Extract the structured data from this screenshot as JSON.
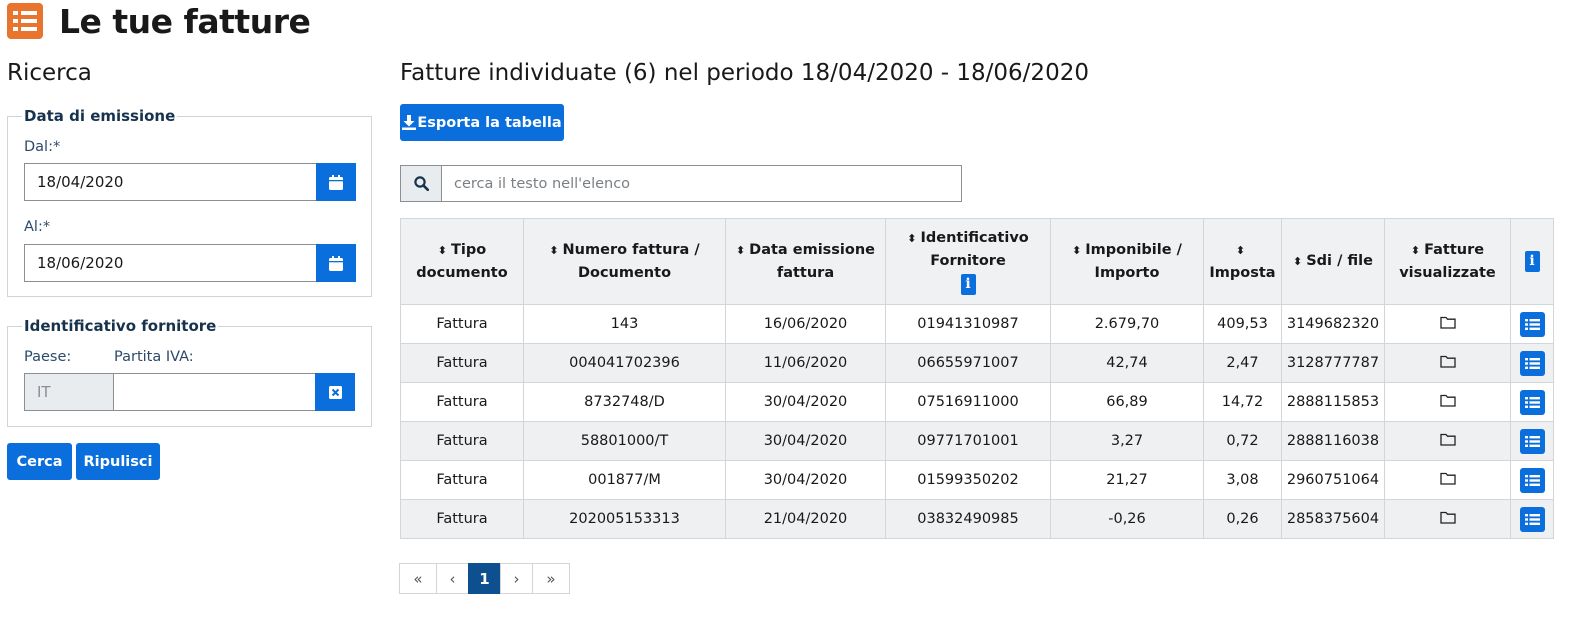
{
  "header": {
    "title": "Le tue fatture",
    "icon": "list-icon"
  },
  "sidebar": {
    "title": "Ricerca",
    "date_group": {
      "legend": "Data di emissione",
      "from_label": "Dal:*",
      "from_value": "18/04/2020",
      "to_label": "Al:*",
      "to_value": "18/06/2020"
    },
    "supplier_group": {
      "legend": "Identificativo fornitore",
      "country_label": "Paese:",
      "vat_label": "Partita IVA:",
      "country_value": "IT",
      "vat_value": ""
    },
    "search_button": "Cerca",
    "reset_button": "Ripulisci"
  },
  "results": {
    "title": "Fatture individuate (6) nel periodo 18/04/2020 - 18/06/2020",
    "export_button": "Esporta la tabella",
    "search_placeholder": "cerca il testo nell'elenco",
    "columns": [
      {
        "l1": "Tipo",
        "l2": "documento"
      },
      {
        "l1": "Numero fattura /",
        "l2": "Documento"
      },
      {
        "l1": "Data emissione",
        "l2": "fattura"
      },
      {
        "l1": "Identificativo",
        "l2": "Fornitore"
      },
      {
        "l1": "Imponibile /",
        "l2": "Importo"
      },
      {
        "l1": "",
        "l2": "Imposta"
      },
      {
        "l1": "Sdi / file",
        "l2": ""
      },
      {
        "l1": "Fatture",
        "l2": "visualizzate"
      }
    ],
    "info_glyph": "i",
    "rows": [
      {
        "tipo": "Fattura",
        "numero": "143",
        "data": "16/06/2020",
        "fornitore": "01941310987",
        "importo": "2.679,70",
        "imposta": "409,53",
        "sdi": "3149682320"
      },
      {
        "tipo": "Fattura",
        "numero": "004041702396",
        "data": "11/06/2020",
        "fornitore": "06655971007",
        "importo": "42,74",
        "imposta": "2,47",
        "sdi": "3128777787"
      },
      {
        "tipo": "Fattura",
        "numero": "8732748/D",
        "data": "30/04/2020",
        "fornitore": "07516911000",
        "importo": "66,89",
        "imposta": "14,72",
        "sdi": "2888115853"
      },
      {
        "tipo": "Fattura",
        "numero": "58801000/T",
        "data": "30/04/2020",
        "fornitore": "09771701001",
        "importo": "3,27",
        "imposta": "0,72",
        "sdi": "2888116038"
      },
      {
        "tipo": "Fattura",
        "numero": "001877/M",
        "data": "30/04/2020",
        "fornitore": "01599350202",
        "importo": "21,27",
        "imposta": "3,08",
        "sdi": "2960751064"
      },
      {
        "tipo": "Fattura",
        "numero": "202005153313",
        "data": "21/04/2020",
        "fornitore": "03832490985",
        "importo": "-0,26",
        "imposta": "0,26",
        "sdi": "2858375604"
      }
    ]
  },
  "pagination": {
    "first": "«",
    "prev": "‹",
    "current": "1",
    "next": "›",
    "last": "»"
  },
  "colors": {
    "primary": "#0a6edc",
    "header_icon": "#e8742e",
    "active_page": "#0d4f8f"
  }
}
